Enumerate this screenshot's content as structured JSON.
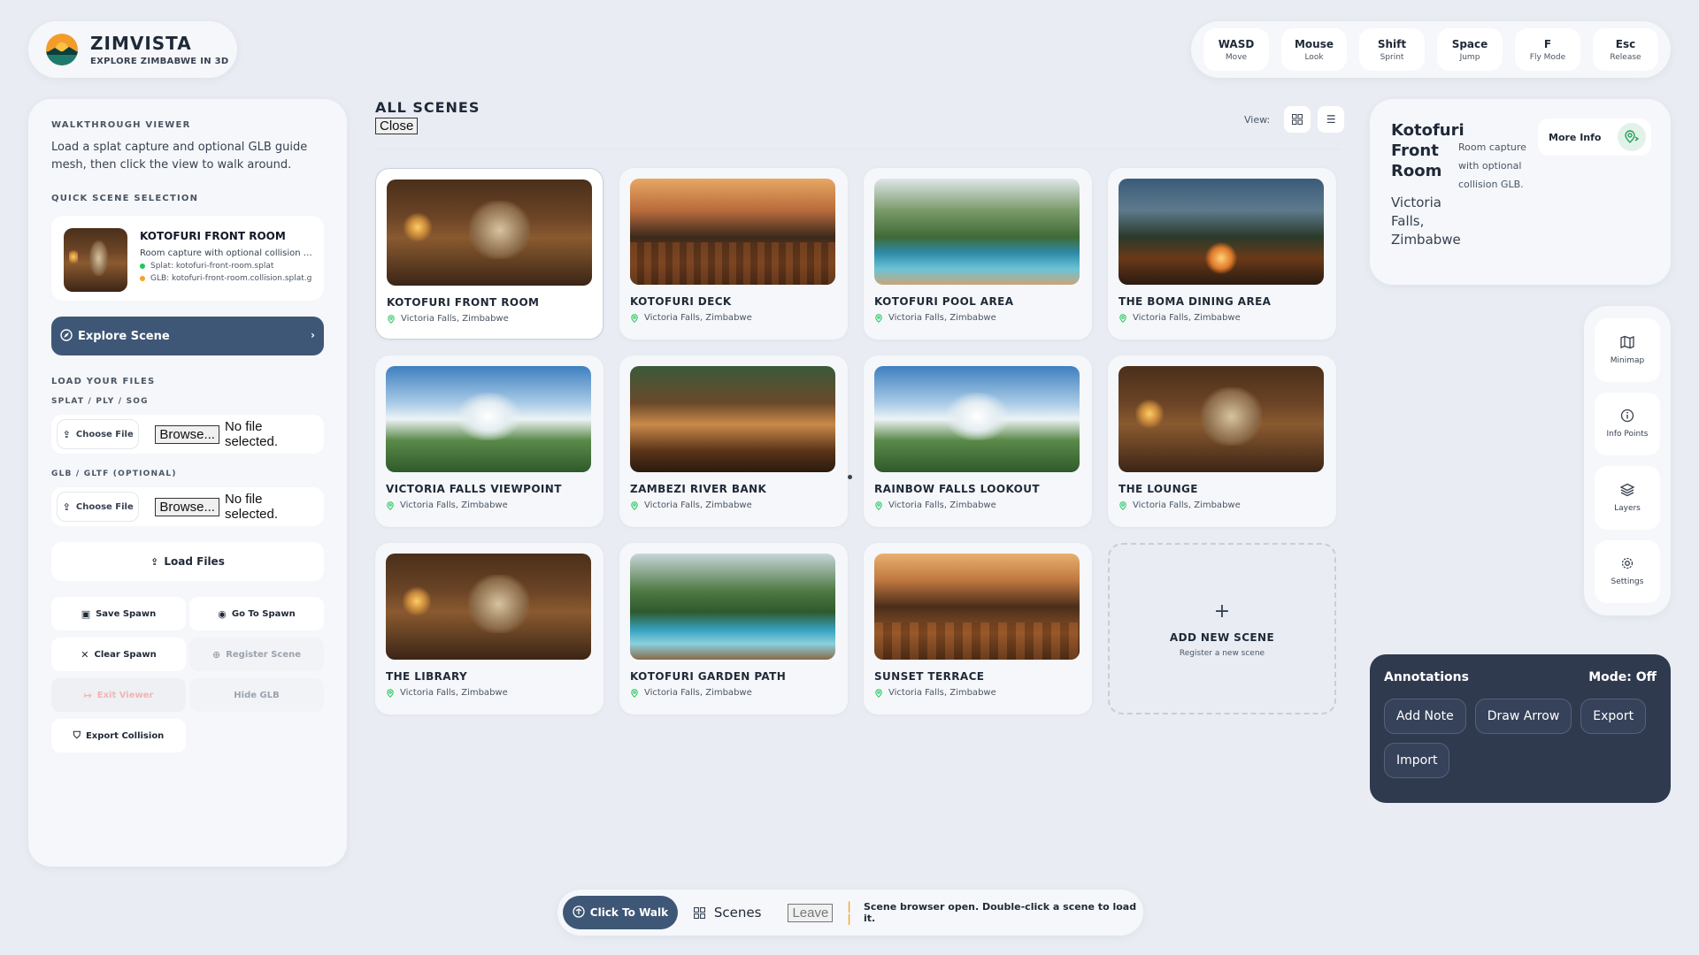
{
  "brand": {
    "title": "ZIMVISTA",
    "subtitle": "EXPLORE ZIMBABWE IN 3D"
  },
  "keys": [
    {
      "key": "WASD",
      "action": "Move"
    },
    {
      "key": "Mouse",
      "action": "Look"
    },
    {
      "key": "Shift",
      "action": "Sprint"
    },
    {
      "key": "Space",
      "action": "Jump"
    },
    {
      "key": "F",
      "action": "Fly Mode"
    },
    {
      "key": "Esc",
      "action": "Release"
    }
  ],
  "sidebar": {
    "walkthrough_label": "WALKTHROUGH VIEWER",
    "walkthrough_desc": "Load a splat capture and optional GLB guide mesh, then click the view to walk around.",
    "quick_label": "QUICK SCENE SELECTION",
    "quick": {
      "name": "KOTOFURI FRONT ROOM",
      "desc": "Room capture with optional collision G...",
      "splat": "Splat: kotofuri-front-room.splat",
      "glb": "GLB: kotofuri-front-room.collision.splat.g"
    },
    "explore_label": "Explore Scene",
    "load_label": "LOAD YOUR FILES",
    "splat_label": "SPLAT / PLY / SOG",
    "glb_label": "GLB / GLTF (OPTIONAL)",
    "choose_label": "Choose File",
    "browse_label": "Browse...",
    "no_file": "No file selected.",
    "load_files": "Load Files",
    "save_spawn": "Save Spawn",
    "go_spawn": "Go To Spawn",
    "clear_spawn": "Clear Spawn",
    "register_scene": "Register Scene",
    "exit_viewer": "Exit Viewer",
    "hide_glb": "Hide GLB",
    "export_collision": "Export Collision"
  },
  "center": {
    "title": "ALL SCENES",
    "close": "Close",
    "view_label": "View:"
  },
  "scenes": [
    {
      "name": "KOTOFURI FRONT ROOM",
      "location": "Victoria Falls, Zimbabwe",
      "img": "room"
    },
    {
      "name": "KOTOFURI DECK",
      "location": "Victoria Falls, Zimbabwe",
      "img": "deck"
    },
    {
      "name": "KOTOFURI POOL AREA",
      "location": "Victoria Falls, Zimbabwe",
      "img": "pool"
    },
    {
      "name": "THE BOMA DINING AREA",
      "location": "Victoria Falls, Zimbabwe",
      "img": "boma"
    },
    {
      "name": "VICTORIA FALLS VIEWPOINT",
      "location": "Victoria Falls, Zimbabwe",
      "img": "falls"
    },
    {
      "name": "ZAMBEZI RIVER BANK",
      "location": "Victoria Falls, Zimbabwe",
      "img": "river"
    },
    {
      "name": "RAINBOW FALLS LOOKOUT",
      "location": "Victoria Falls, Zimbabwe",
      "img": "falls"
    },
    {
      "name": "THE LOUNGE",
      "location": "Victoria Falls, Zimbabwe",
      "img": "room"
    },
    {
      "name": "THE LIBRARY",
      "location": "Victoria Falls, Zimbabwe",
      "img": "room"
    },
    {
      "name": "KOTOFURI GARDEN PATH",
      "location": "Victoria Falls, Zimbabwe",
      "img": "garden"
    },
    {
      "name": "SUNSET TERRACE",
      "location": "Victoria Falls, Zimbabwe",
      "img": "sunset"
    }
  ],
  "add_scene": {
    "title": "ADD NEW SCENE",
    "subtitle": "Register a new scene"
  },
  "info": {
    "title": "Kotofuri Front Room",
    "desc": "Room capture with optional collision GLB.",
    "location": "Victoria Falls, Zimbabwe",
    "more_info": "More Info"
  },
  "tools": [
    {
      "label": "Minimap",
      "icon": "map-icon"
    },
    {
      "label": "Info Points",
      "icon": "info-icon"
    },
    {
      "label": "Layers",
      "icon": "layers-icon"
    },
    {
      "label": "Settings",
      "icon": "gear-icon"
    }
  ],
  "annotations": {
    "title": "Annotations",
    "mode": "Mode: Off",
    "buttons": [
      "Add Note",
      "Draw Arrow",
      "Export",
      "Import"
    ]
  },
  "bottom": {
    "walk": "Click To Walk",
    "scenes": "Scenes",
    "leave": "Leave",
    "status": "Scene browser open. Double-click a scene to load it."
  },
  "colors": {
    "accent": "#3f5777",
    "annot_bg": "#2f3a4e",
    "status_warn": "#f5a524",
    "pin_green": "#22c55e"
  }
}
